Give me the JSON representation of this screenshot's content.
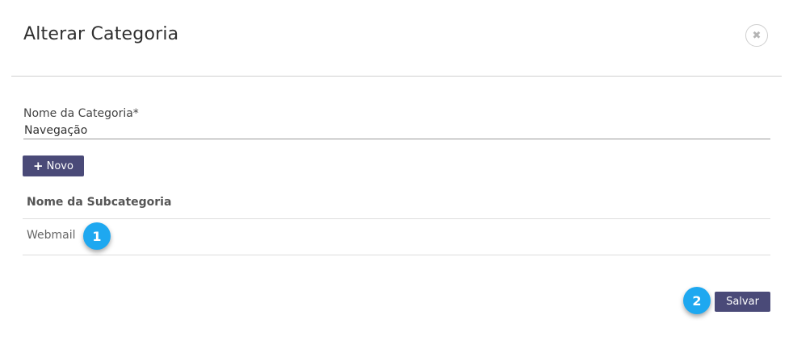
{
  "modal": {
    "title": "Alterar Categoria",
    "close_icon": "close-icon"
  },
  "form": {
    "category_label": "Nome da Categoria*",
    "category_value": "Navegação"
  },
  "toolbar": {
    "new_icon": "plus-icon",
    "new_label": "Novo"
  },
  "table": {
    "column_header": "Nome da Subcategoria",
    "rows": [
      {
        "name": "Webmail"
      }
    ]
  },
  "annotations": {
    "badge_1": "1",
    "badge_2": "2",
    "badge_color": "#1ea8f0"
  },
  "footer": {
    "save_label": "Salvar"
  },
  "colors": {
    "button_bg": "#4a4a78",
    "divider": "#cfcfcf"
  }
}
